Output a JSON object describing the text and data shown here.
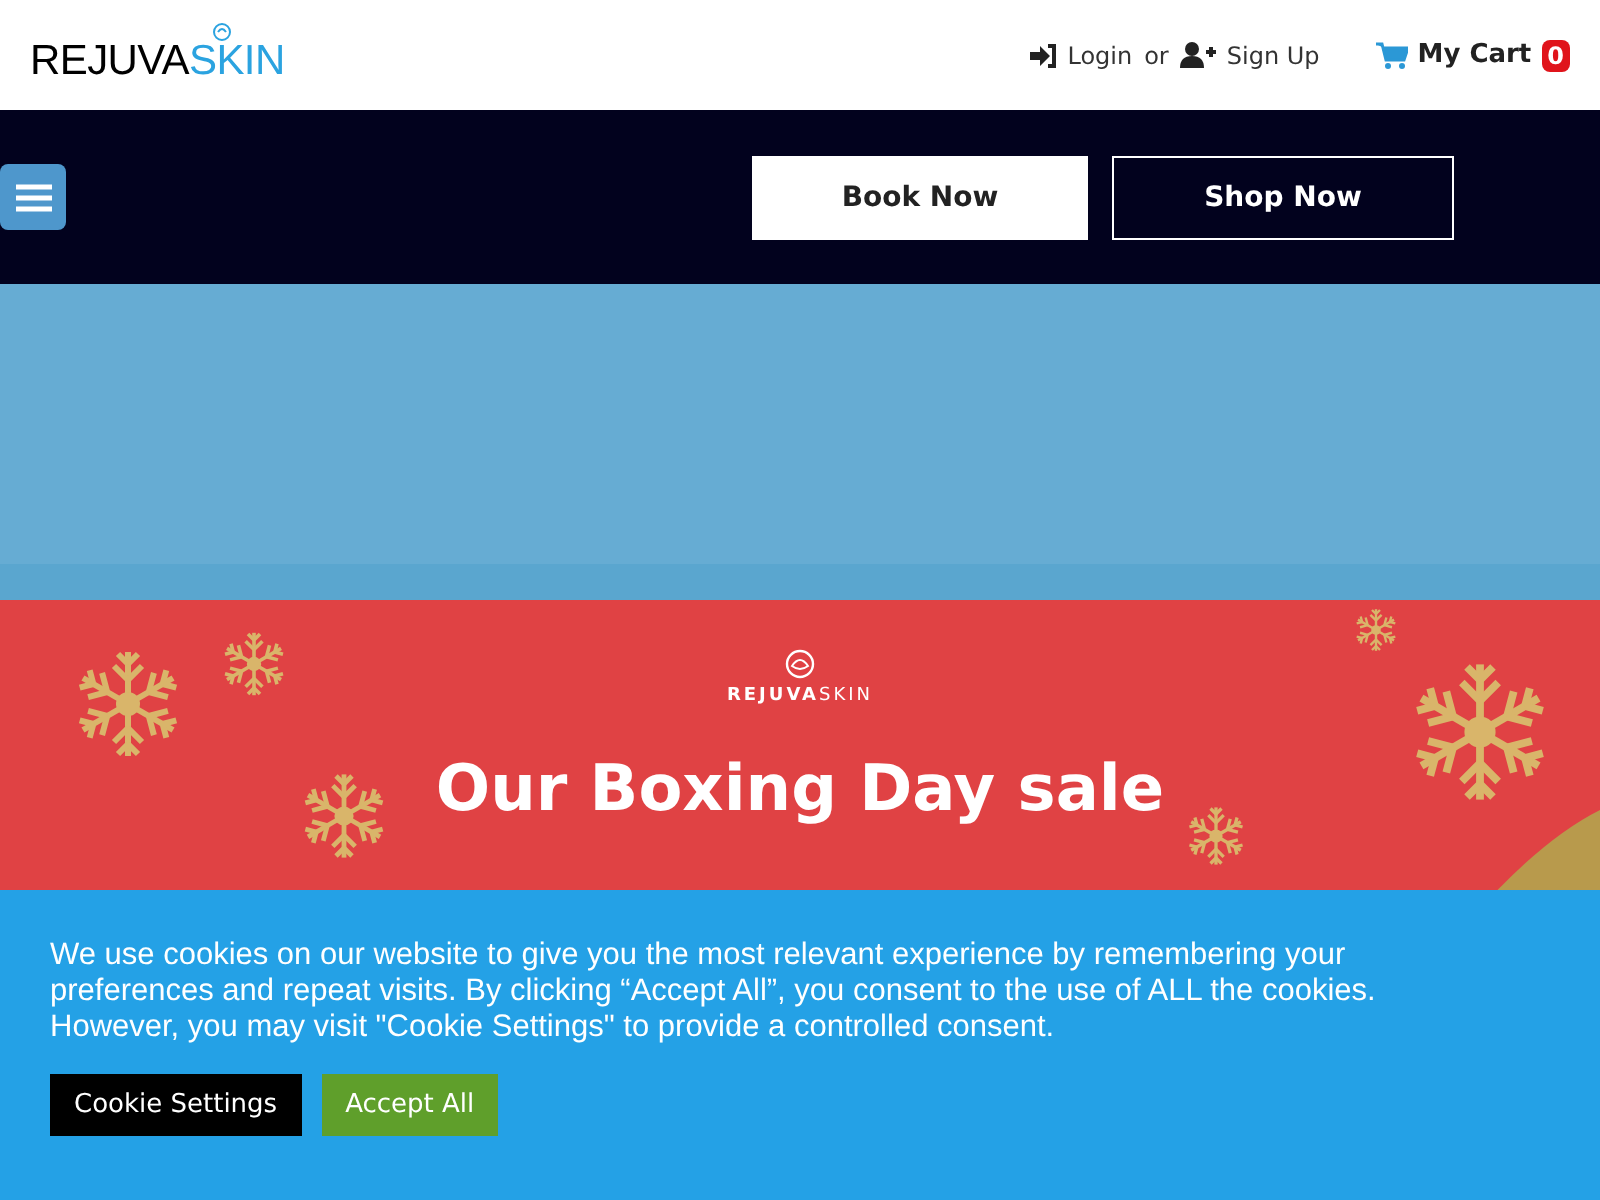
{
  "header": {
    "logo": {
      "part_1": "REJUVA",
      "part_2": "SKIN"
    },
    "login": "Login",
    "or": "or",
    "signup": "Sign Up",
    "cart": {
      "label": "My Cart",
      "count": "0"
    }
  },
  "nav": {
    "buttons": [
      {
        "label": "Book Now",
        "kind": "filled"
      },
      {
        "label": "Shop Now",
        "kind": "outline"
      }
    ]
  },
  "banner": {
    "logo": {
      "part_1": "REJUVA",
      "part_2": "SKIN"
    },
    "headline": "Our Boxing Day sale"
  },
  "cookie_bar": {
    "message": "We use cookies on our website to give you the most relevant experience by remembering your preferences and repeat visits. By clicking “Accept All”, you consent to the use of ALL the cookies. However, you may visit \"Cookie Settings\" to provide a controlled consent.",
    "buttons": [
      {
        "label": "Cookie Settings",
        "kind": "dark"
      },
      {
        "label": "Accept All",
        "kind": "accept"
      }
    ]
  }
}
